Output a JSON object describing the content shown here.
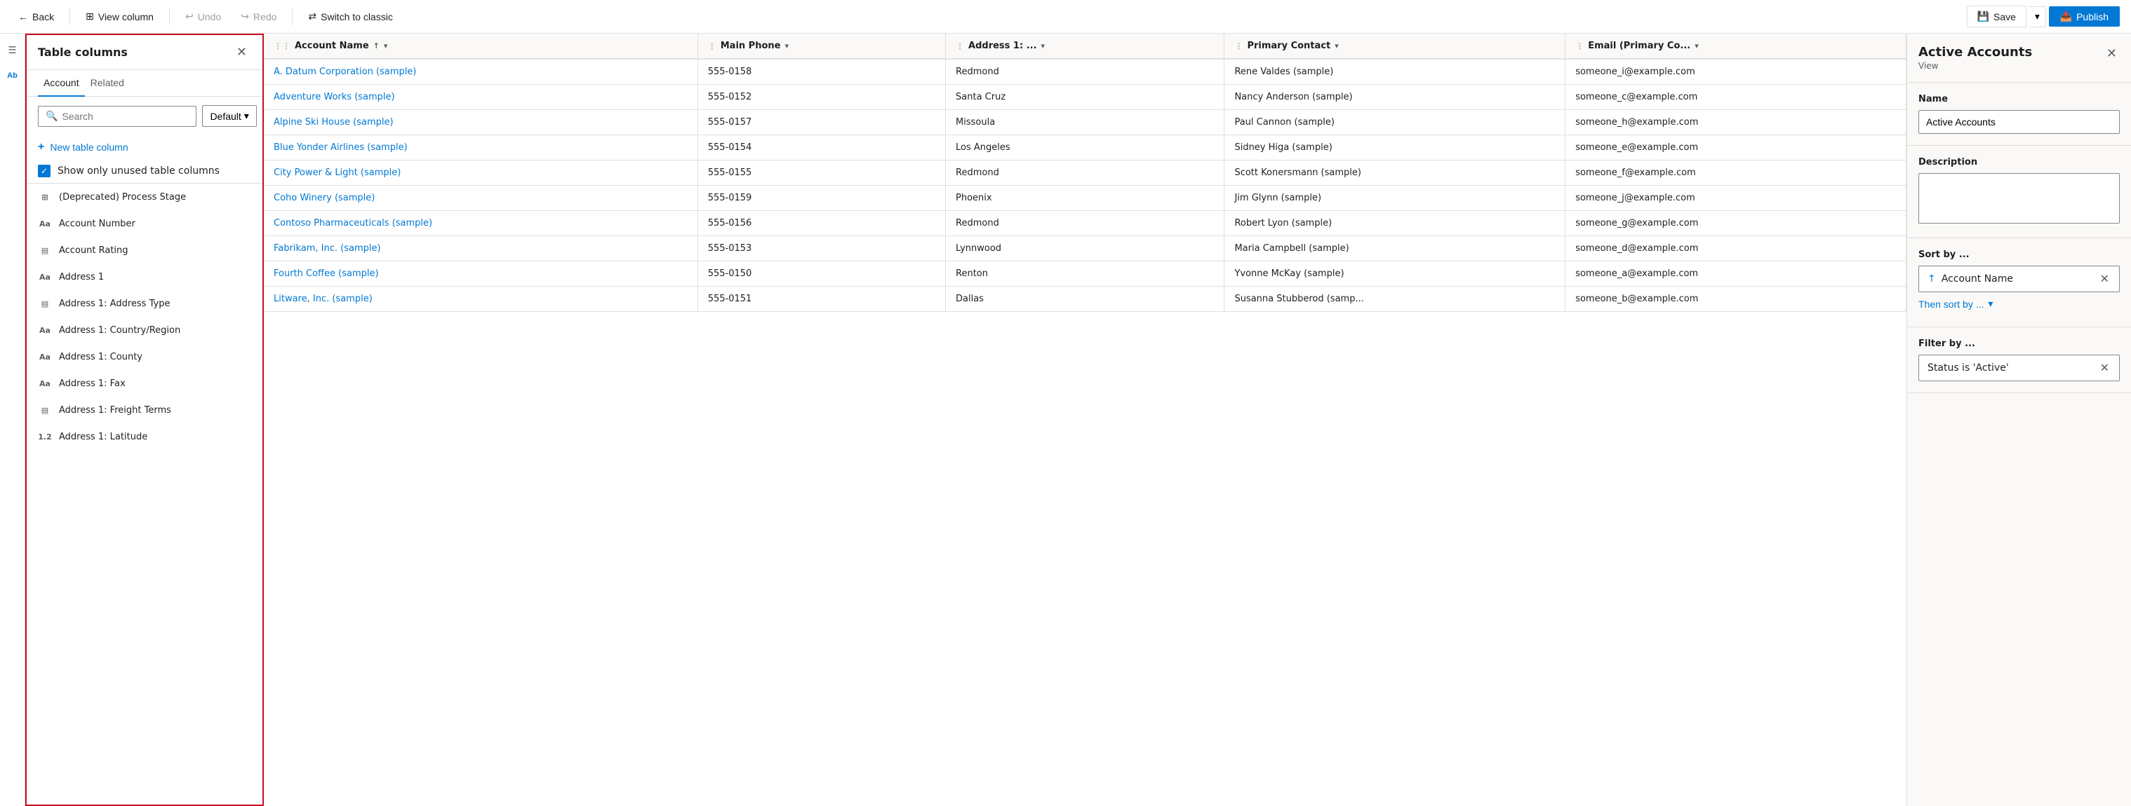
{
  "toolbar": {
    "back_label": "Back",
    "view_column_label": "View column",
    "undo_label": "Undo",
    "redo_label": "Redo",
    "switch_classic_label": "Switch to classic",
    "save_label": "Save",
    "publish_label": "Publish"
  },
  "panel": {
    "title": "Table columns",
    "tabs": [
      "Account",
      "Related"
    ],
    "active_tab": 0,
    "search_placeholder": "Search",
    "search_value": "",
    "default_dropdown": "Default",
    "new_column_label": "New table column",
    "unused_checkbox_label": "Show only unused table columns",
    "columns": [
      {
        "icon": "grid-icon",
        "label": "(Deprecated) Process Stage"
      },
      {
        "icon": "text-icon",
        "label": "Account Number"
      },
      {
        "icon": "select-icon",
        "label": "Account Rating"
      },
      {
        "icon": "text-icon",
        "label": "Address 1"
      },
      {
        "icon": "select-icon",
        "label": "Address 1: Address Type"
      },
      {
        "icon": "text-icon",
        "label": "Address 1: Country/Region"
      },
      {
        "icon": "text-icon",
        "label": "Address 1: County"
      },
      {
        "icon": "text-icon",
        "label": "Address 1: Fax"
      },
      {
        "icon": "select-icon",
        "label": "Address 1: Freight Terms"
      },
      {
        "icon": "decimal-icon",
        "label": "Address 1: Latitude"
      }
    ]
  },
  "grid": {
    "columns": [
      {
        "label": "Account Name",
        "sortable": true,
        "filtered": true
      },
      {
        "label": "Main Phone",
        "sortable": false,
        "filtered": true
      },
      {
        "label": "Address 1: ...",
        "sortable": false,
        "filtered": true
      },
      {
        "label": "Primary Contact",
        "sortable": false,
        "filtered": true
      },
      {
        "label": "Email (Primary Co...",
        "sortable": false,
        "filtered": true
      }
    ],
    "rows": [
      {
        "name": "A. Datum Corporation (sample)",
        "phone": "555-0158",
        "address": "Redmond",
        "contact": "Rene Valdes (sample)",
        "email": "someone_i@example.com"
      },
      {
        "name": "Adventure Works (sample)",
        "phone": "555-0152",
        "address": "Santa Cruz",
        "contact": "Nancy Anderson (sample)",
        "email": "someone_c@example.com"
      },
      {
        "name": "Alpine Ski House (sample)",
        "phone": "555-0157",
        "address": "Missoula",
        "contact": "Paul Cannon (sample)",
        "email": "someone_h@example.com"
      },
      {
        "name": "Blue Yonder Airlines (sample)",
        "phone": "555-0154",
        "address": "Los Angeles",
        "contact": "Sidney Higa (sample)",
        "email": "someone_e@example.com"
      },
      {
        "name": "City Power & Light (sample)",
        "phone": "555-0155",
        "address": "Redmond",
        "contact": "Scott Konersmann (sample)",
        "email": "someone_f@example.com"
      },
      {
        "name": "Coho Winery (sample)",
        "phone": "555-0159",
        "address": "Phoenix",
        "contact": "Jim Glynn (sample)",
        "email": "someone_j@example.com"
      },
      {
        "name": "Contoso Pharmaceuticals (sample)",
        "phone": "555-0156",
        "address": "Redmond",
        "contact": "Robert Lyon (sample)",
        "email": "someone_g@example.com"
      },
      {
        "name": "Fabrikam, Inc. (sample)",
        "phone": "555-0153",
        "address": "Lynnwood",
        "contact": "Maria Campbell (sample)",
        "email": "someone_d@example.com"
      },
      {
        "name": "Fourth Coffee (sample)",
        "phone": "555-0150",
        "address": "Renton",
        "contact": "Yvonne McKay (sample)",
        "email": "someone_a@example.com"
      },
      {
        "name": "Litware, Inc. (sample)",
        "phone": "555-0151",
        "address": "Dallas",
        "contact": "Susanna Stubberod (samp...",
        "email": "someone_b@example.com"
      }
    ]
  },
  "right_panel": {
    "title": "Active Accounts",
    "subtitle": "View",
    "name_label": "Name",
    "name_value": "Active Accounts",
    "description_label": "Description",
    "description_value": "",
    "sort_label": "Sort by ...",
    "sort_item": "Account Name",
    "then_sort_label": "Then sort by ...",
    "filter_label": "Filter by ...",
    "filter_item": "Status is 'Active'"
  },
  "icons": {
    "back": "←",
    "view_column": "⊞",
    "undo": "↩",
    "redo": "↪",
    "switch": "⇄",
    "save": "💾",
    "publish": "📤",
    "search": "🔍",
    "close": "✕",
    "plus": "+",
    "check": "✓",
    "sort_asc": "↑",
    "sort_desc": "↓",
    "chevron_down": "⌄",
    "remove": "✕",
    "hamburger": "☰",
    "text_icon": "Aa",
    "select_icon": "▤",
    "grid_icon": "⊞",
    "decimal_icon": "1.2"
  }
}
